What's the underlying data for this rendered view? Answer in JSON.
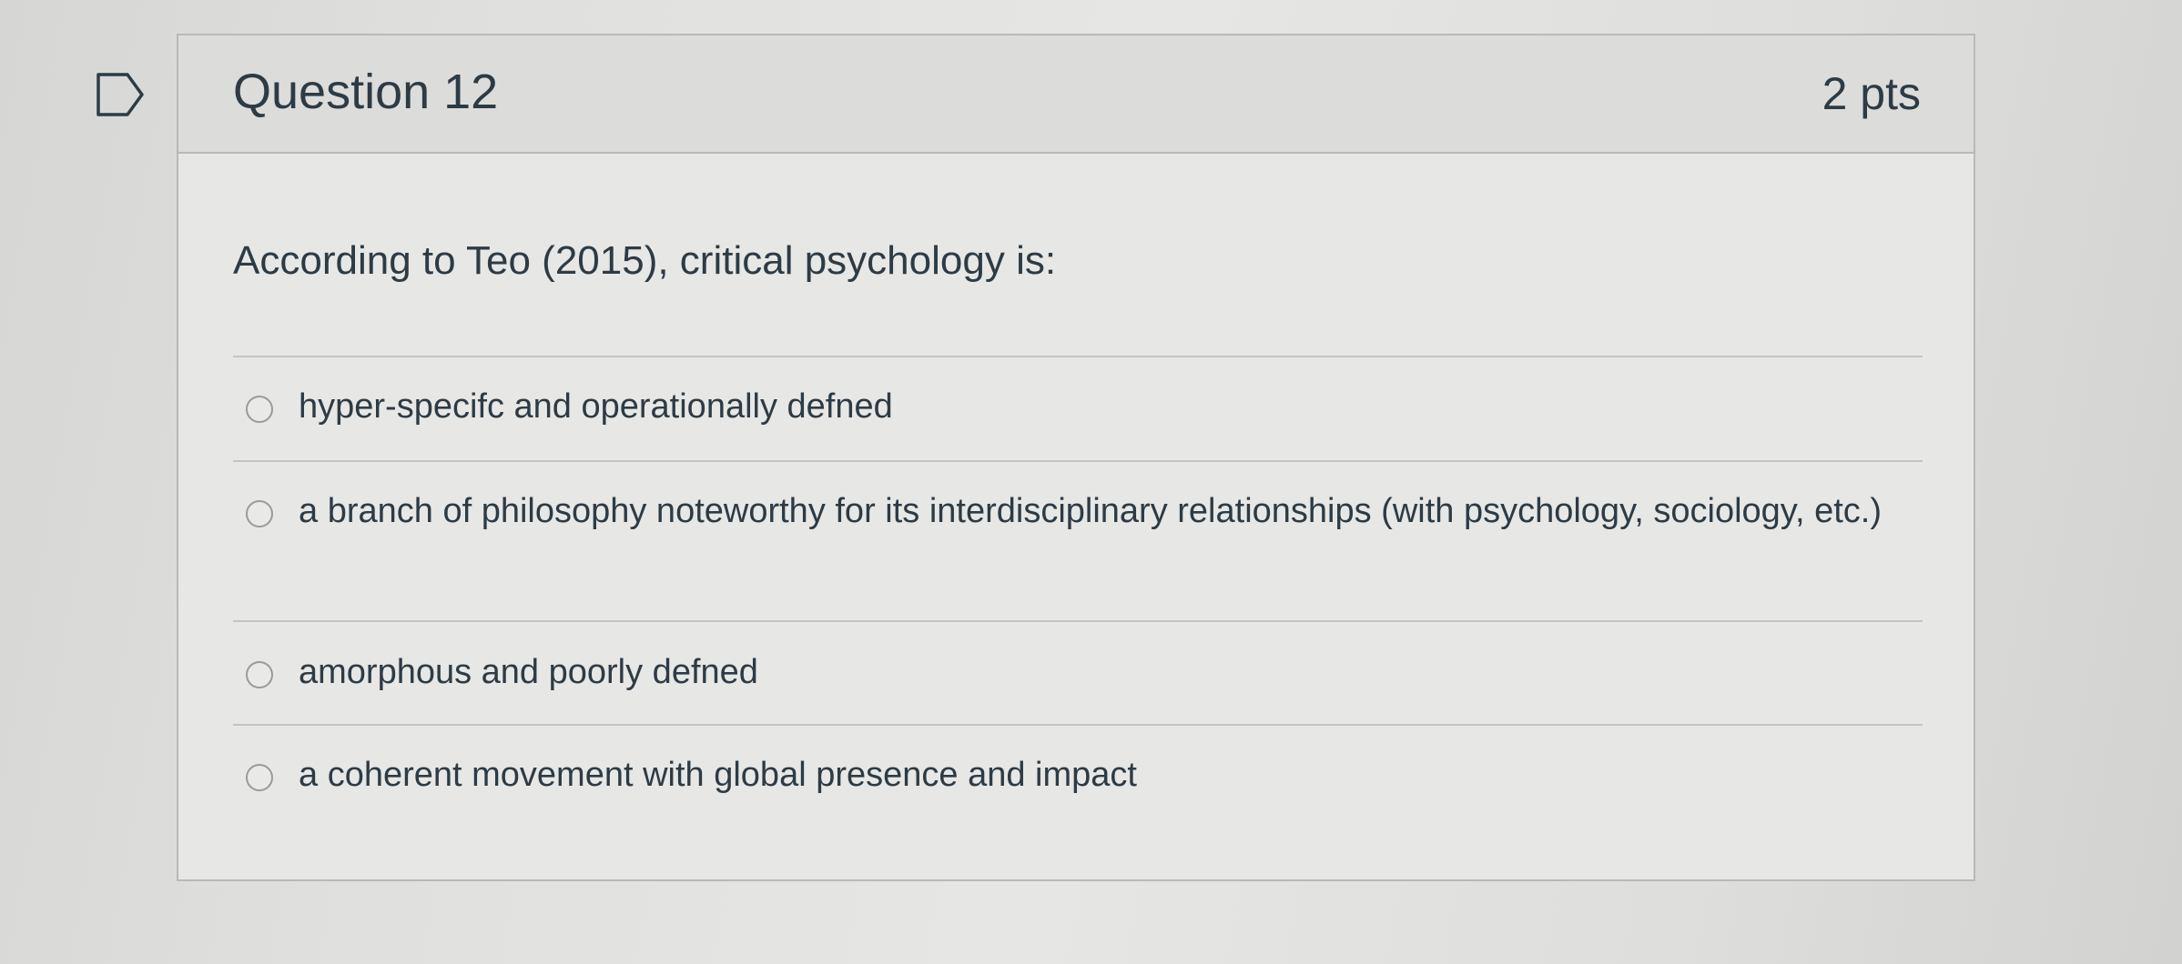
{
  "question": {
    "title": "Question 12",
    "points": "2 pts",
    "text": "According to Teo (2015), critical psychology is:",
    "flag_icon": "bookmark-flag-icon"
  },
  "answers": [
    {
      "label": "hyper-specifc and operationally defned",
      "selected": false
    },
    {
      "label": "a branch of philosophy noteworthy for its interdisciplinary relationships (with psychology, sociology, etc.)",
      "selected": false
    },
    {
      "label": "amorphous and poorly defned",
      "selected": false
    },
    {
      "label": "a coherent movement with global presence and impact",
      "selected": false
    }
  ],
  "colors": {
    "text": "#2d3b45",
    "border": "#b9b9b7",
    "header_bg": "#dcdcda",
    "card_bg": "#e7e7e5"
  }
}
